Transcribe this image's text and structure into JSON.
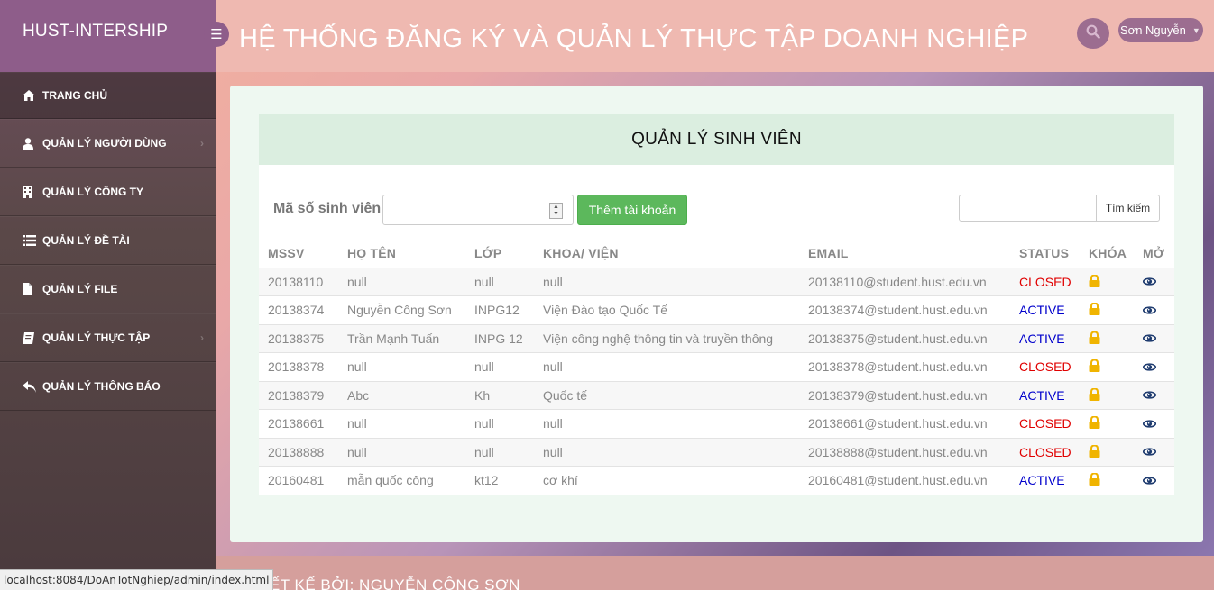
{
  "brand": "HUST-INTERSHIP",
  "header": {
    "title": "HỆ THỐNG ĐĂNG KÝ VÀ QUẢN LÝ THỰC TẬP DOANH NGHIỆP",
    "user_name": "Sơn Nguyễn"
  },
  "sidebar": {
    "items": [
      {
        "label": "TRANG CHỦ",
        "icon": "home-icon"
      },
      {
        "label": "QUẢN LÝ NGƯỜI DÙNG",
        "icon": "user-icon"
      },
      {
        "label": "QUẢN LÝ CÔNG TY",
        "icon": "building-icon"
      },
      {
        "label": "QUẢN LÝ ĐỀ TÀI",
        "icon": "list-icon"
      },
      {
        "label": "QUẢN LÝ FILE",
        "icon": "file-icon"
      },
      {
        "label": "QUẢN LÝ THỰC TẬP",
        "icon": "book-icon"
      },
      {
        "label": "QUẢN LÝ THÔNG BÁO",
        "icon": "reply-icon"
      }
    ]
  },
  "panel": {
    "title": "QUẢN LÝ SINH VIÊN",
    "mssv_label": "Mã số sinh viên:",
    "mssv_value": "",
    "add_button": "Thêm tài khoản",
    "search_value": "",
    "search_button": "Tìm kiếm"
  },
  "table": {
    "headers": [
      "MSSV",
      "HỌ TÊN",
      "LỚP",
      "KHOA/ VIỆN",
      "EMAIL",
      "STATUS",
      "KHÓA",
      "MỞ"
    ],
    "rows": [
      {
        "mssv": "20138110",
        "name": "null",
        "class": "null",
        "faculty": "null",
        "email": "20138110@student.hust.edu.vn",
        "status": "CLOSED"
      },
      {
        "mssv": "20138374",
        "name": "Nguyễn Công Sơn",
        "class": "INPG12",
        "faculty": "Viện Đào tạo Quốc Tế",
        "email": "20138374@student.hust.edu.vn",
        "status": "ACTIVE"
      },
      {
        "mssv": "20138375",
        "name": "Trần Mạnh Tuấn",
        "class": "INPG 12",
        "faculty": "Viện công nghệ thông tin và truyền thông",
        "email": "20138375@student.hust.edu.vn",
        "status": "ACTIVE"
      },
      {
        "mssv": "20138378",
        "name": "null",
        "class": "null",
        "faculty": "null",
        "email": "20138378@student.hust.edu.vn",
        "status": "CLOSED"
      },
      {
        "mssv": "20138379",
        "name": "Abc",
        "class": "Kh",
        "faculty": "Quốc tế",
        "email": "20138379@student.hust.edu.vn",
        "status": "ACTIVE"
      },
      {
        "mssv": "20138661",
        "name": "null",
        "class": "null",
        "faculty": "null",
        "email": "20138661@student.hust.edu.vn",
        "status": "CLOSED"
      },
      {
        "mssv": "20138888",
        "name": "null",
        "class": "null",
        "faculty": "null",
        "email": "20138888@student.hust.edu.vn",
        "status": "CLOSED"
      },
      {
        "mssv": "20160481",
        "name": "mẫn quốc công",
        "class": "kt12",
        "faculty": "cơ khí",
        "email": "20160481@student.hust.edu.vn",
        "status": "ACTIVE"
      }
    ]
  },
  "footer": {
    "text": "THIẾT KẾ BỞI: NGUYỄN CÔNG SƠN"
  },
  "status_bar_url": "localhost:8084/DoAnTotNghiep/admin/index.html",
  "colors": {
    "closed": "#e00000",
    "active": "#0000cc",
    "lock": "#f0b400",
    "eye": "#1d3a6e",
    "add_button": "#5cb85c"
  }
}
